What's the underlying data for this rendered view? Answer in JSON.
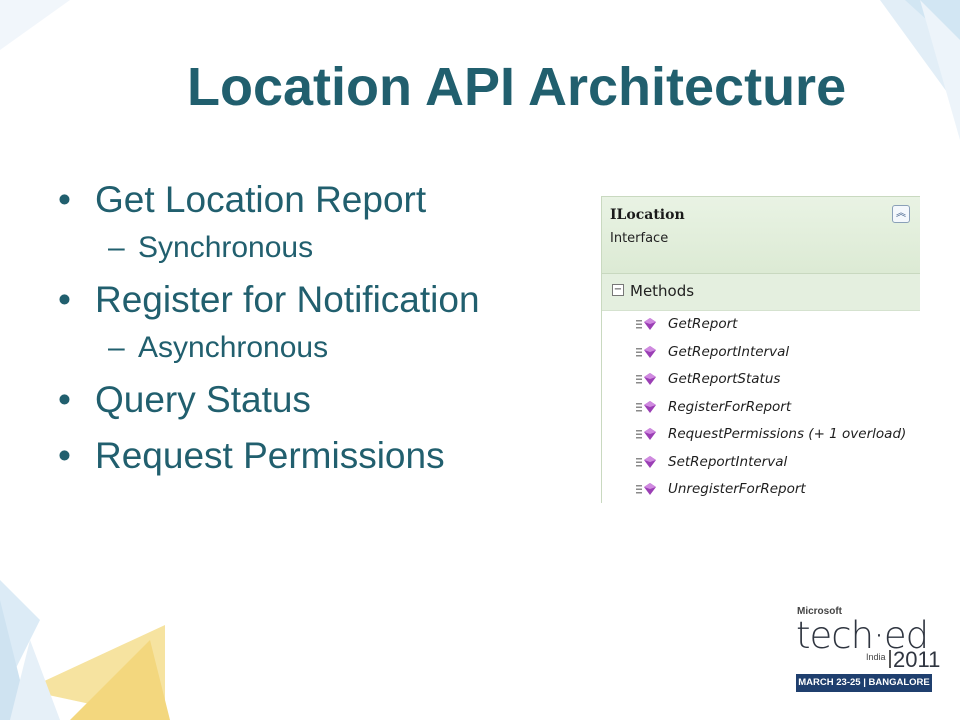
{
  "slide": {
    "title": "Location API Architecture",
    "bullets": [
      {
        "text": "Get Location Report",
        "sub": "Synchronous"
      },
      {
        "text": "Register for Notification",
        "sub": "Asynchronous"
      },
      {
        "text": "Query Status"
      },
      {
        "text": "Request Permissions"
      }
    ],
    "bullet_symbol": "•",
    "dash_symbol": "–"
  },
  "diagram": {
    "name": "ILocation",
    "kind": "Interface",
    "section": "Methods",
    "methods": [
      "GetReport",
      "GetReportInterval",
      "GetReportStatus",
      "RegisterForReport",
      "RequestPermissions (+ 1 overload)",
      "SetReportInterval",
      "UnregisterForReport"
    ],
    "collapse_icon": "double-chevron-up-icon",
    "method_icon": "purple-method-icon"
  },
  "logo": {
    "brand": "Microsoft",
    "product": "tech·ed",
    "region": "India",
    "year": "2011",
    "event": "MARCH 23-25 | BANGALORE"
  },
  "colors": {
    "title": "#215f6e",
    "deco_blue": "#d6e9f5",
    "deco_yellow": "#f6e3a0",
    "logo_band": "#1f3f6e"
  }
}
